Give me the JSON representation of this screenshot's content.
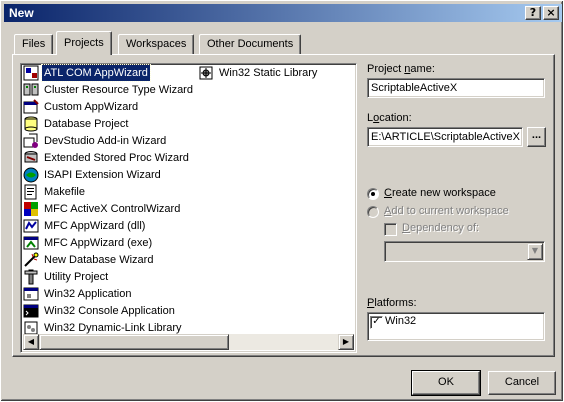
{
  "window": {
    "title": "New",
    "help_button": "?",
    "close_button": "×"
  },
  "tabs": [
    {
      "label": "Files",
      "active": false
    },
    {
      "label": "Projects",
      "active": true
    },
    {
      "label": "Workspaces",
      "active": false
    },
    {
      "label": "Other Documents",
      "active": false
    }
  ],
  "project_types": {
    "column1": [
      {
        "label": "ATL COM AppWizard",
        "icon": "atl-com-icon",
        "selected": true
      },
      {
        "label": "Cluster Resource Type Wizard",
        "icon": "cluster-icon"
      },
      {
        "label": "Custom AppWizard",
        "icon": "custom-wizard-icon"
      },
      {
        "label": "Database Project",
        "icon": "database-icon"
      },
      {
        "label": "DevStudio Add-in Wizard",
        "icon": "addin-icon"
      },
      {
        "label": "Extended Stored Proc Wizard",
        "icon": "stored-proc-icon"
      },
      {
        "label": "ISAPI Extension Wizard",
        "icon": "isapi-icon"
      },
      {
        "label": "Makefile",
        "icon": "makefile-icon"
      },
      {
        "label": "MFC ActiveX ControlWizard",
        "icon": "activex-icon"
      },
      {
        "label": "MFC AppWizard (dll)",
        "icon": "mfc-dll-icon"
      },
      {
        "label": "MFC AppWizard (exe)",
        "icon": "mfc-exe-icon"
      },
      {
        "label": "New Database Wizard",
        "icon": "new-database-icon"
      },
      {
        "label": "Utility Project",
        "icon": "utility-icon"
      },
      {
        "label": "Win32 Application",
        "icon": "win32-app-icon"
      },
      {
        "label": "Win32 Console Application",
        "icon": "console-icon"
      },
      {
        "label": "Win32 Dynamic-Link Library",
        "icon": "dll-icon"
      }
    ],
    "column2": [
      {
        "label": "Win32 Static Library",
        "icon": "static-lib-icon"
      }
    ]
  },
  "form": {
    "project_name_label_pre": "Project ",
    "project_name_label_ul": "n",
    "project_name_label_post": "ame:",
    "project_name_value": "ScriptableActiveX",
    "location_label_pre": "L",
    "location_label_ul": "o",
    "location_label_post": "cation:",
    "location_value": "E:\\ARTICLE\\ScriptableActiveX",
    "browse_label": "...",
    "radio_create_pre": "",
    "radio_create_ul": "C",
    "radio_create_post": "reate new workspace",
    "radio_create_checked": true,
    "radio_add_pre": "",
    "radio_add_ul": "A",
    "radio_add_post": "dd to current workspace",
    "dependency_pre": "",
    "dependency_ul": "D",
    "dependency_post": "ependency of:",
    "platforms_label_pre": "",
    "platforms_label_ul": "P",
    "platforms_label_post": "latforms:",
    "platforms": [
      {
        "label": "Win32",
        "checked": true
      }
    ]
  },
  "buttons": {
    "ok": "OK",
    "cancel": "Cancel"
  },
  "colors": {
    "titlebar_start": "#0a246a",
    "titlebar_end": "#a6caf0",
    "face": "#d4d0c8",
    "selection": "#0a246a"
  }
}
